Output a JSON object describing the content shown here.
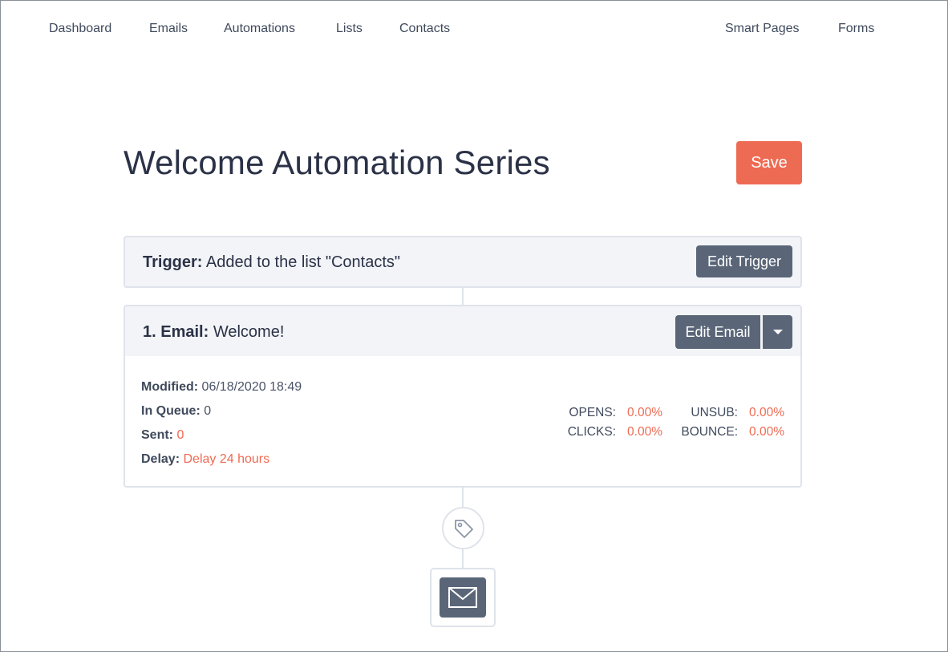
{
  "nav": {
    "dashboard": "Dashboard",
    "emails": "Emails",
    "automations": "Automations",
    "lists": "Lists",
    "contacts": "Contacts",
    "smart_pages": "Smart Pages",
    "forms": "Forms"
  },
  "page": {
    "title": "Welcome Automation Series",
    "save_label": "Save"
  },
  "trigger": {
    "label": "Trigger:",
    "text": "Added to the list \"Contacts\"",
    "edit_label": "Edit Trigger"
  },
  "email_step": {
    "label": "1. Email:",
    "name": "Welcome!",
    "edit_label": "Edit Email",
    "modified_label": "Modified:",
    "modified_value": "06/18/2020 18:49",
    "queue_label": "In Queue:",
    "queue_value": "0",
    "sent_label": "Sent:",
    "sent_value": "0",
    "delay_label": "Delay:",
    "delay_value": "Delay 24 hours",
    "stats": {
      "opens_label": "OPENS:",
      "opens_value": "0.00%",
      "clicks_label": "CLICKS:",
      "clicks_value": "0.00%",
      "unsub_label": "UNSUB:",
      "unsub_value": "0.00%",
      "bounce_label": "BOUNCE:",
      "bounce_value": "0.00%"
    }
  },
  "icons": {
    "tag": "tag-icon",
    "email": "envelope-icon",
    "dropdown": "chevron-down-icon"
  },
  "colors": {
    "accent": "#ee6b53",
    "button_dark": "#5a6678",
    "card_bg": "#f2f4f7",
    "border": "#dfe3ea",
    "title": "#2b3247"
  }
}
